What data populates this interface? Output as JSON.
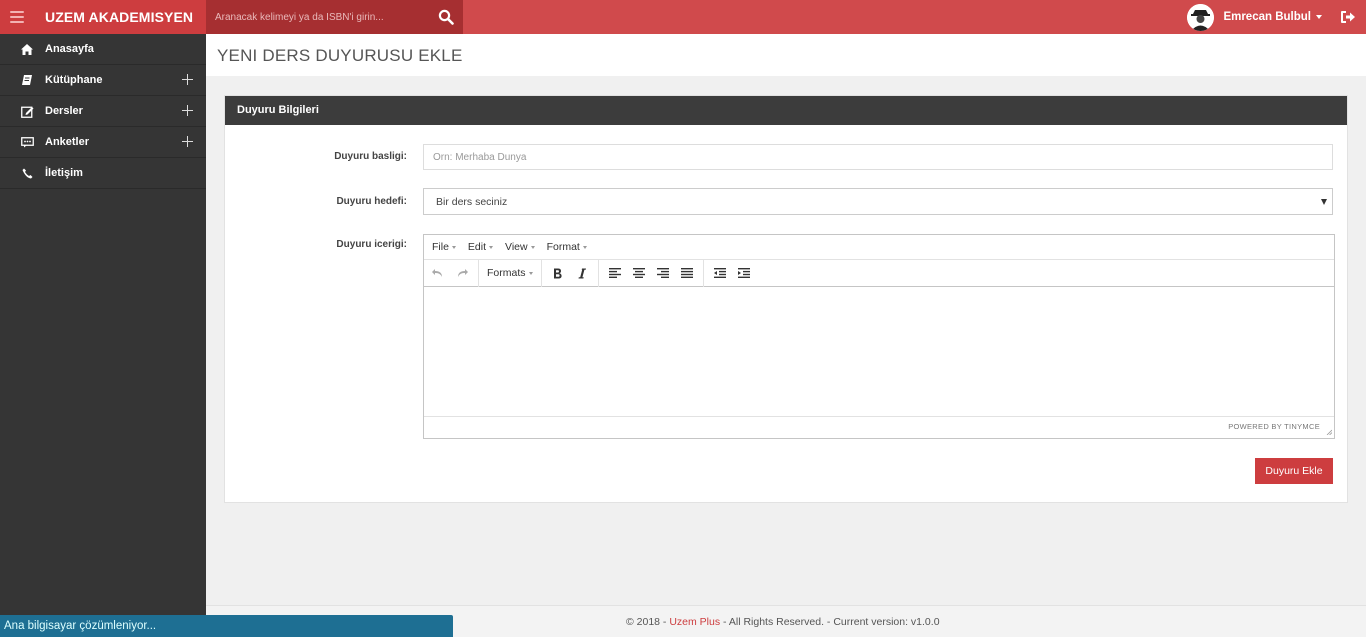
{
  "topbar": {
    "brand": "UZEM AKADEMISYEN",
    "search_placeholder": "Aranacak kelimeyi ya da ISBN'i girin...",
    "user_name": "Emrecan Bulbul",
    "color": "#d04a4c"
  },
  "sidebar": {
    "items": [
      {
        "label": "Anasayfa",
        "icon": "home-icon"
      },
      {
        "label": "Kütüphane",
        "icon": "book-icon"
      },
      {
        "label": "Dersler",
        "icon": "edit-icon"
      },
      {
        "label": "Anketler",
        "icon": "poll-icon"
      },
      {
        "label": "İletişim",
        "icon": "phone-icon"
      }
    ]
  },
  "page": {
    "title": "YENI DERS DUYURUSU EKLE"
  },
  "panel": {
    "heading": "Duyuru Bilgileri",
    "title_label": "Duyuru basligi:",
    "title_placeholder": "Orn: Merhaba Dunya",
    "target_label": "Duyuru hedefi:",
    "target_selected": "Bir ders seciniz",
    "content_label": "Duyuru icerigi:",
    "submit_label": "Duyuru Ekle"
  },
  "editor": {
    "menu": [
      "File",
      "Edit",
      "View",
      "Format"
    ],
    "formats_label": "Formats",
    "powered_by": "POWERED BY TINYMCE"
  },
  "footer": {
    "prefix": "© 2018 - ",
    "link": "Uzem Plus",
    "suffix": " - All Rights Reserved. - Current version: v1.0.0"
  },
  "status_bubble": "Ana bilgisayar çözümleniyor..."
}
